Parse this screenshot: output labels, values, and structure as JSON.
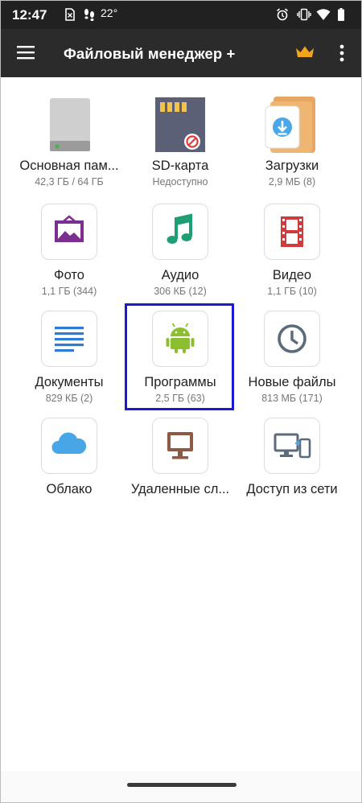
{
  "status_bar": {
    "time": "12:47",
    "temperature": "22°",
    "icons": [
      "sim-icon",
      "footsteps-icon",
      "alarm-icon",
      "vibrate-icon",
      "wifi-icon",
      "battery-icon"
    ]
  },
  "app_bar": {
    "title": "Файловый менеджер +",
    "icons": [
      "menu-icon",
      "crown-icon",
      "more-vert-icon"
    ],
    "accent_color": "#f2a51a"
  },
  "tiles": [
    {
      "label": "Основная пам...",
      "sub": "42,3 ГБ / 64 ГБ",
      "icon": "storage-drive-icon"
    },
    {
      "label": "SD-карта",
      "sub": "Недоступно",
      "icon": "sd-card-icon"
    },
    {
      "label": "Загрузки",
      "sub": "2,9 МБ (8)",
      "icon": "downloads-folder-icon"
    },
    {
      "label": "Фото",
      "sub": "1,1 ГБ (344)",
      "icon": "photo-icon"
    },
    {
      "label": "Аудио",
      "sub": "306 КБ (12)",
      "icon": "music-note-icon"
    },
    {
      "label": "Видео",
      "sub": "1,1 ГБ (10)",
      "icon": "film-icon"
    },
    {
      "label": "Документы",
      "sub": "829 КБ (2)",
      "icon": "document-lines-icon"
    },
    {
      "label": "Программы",
      "sub": "2,5 ГБ (63)",
      "icon": "android-icon"
    },
    {
      "label": "Новые файлы",
      "sub": "813 МБ (171)",
      "icon": "clock-icon"
    },
    {
      "label": "Облако",
      "sub": "",
      "icon": "cloud-icon"
    },
    {
      "label": "Удаленные сл...",
      "sub": "",
      "icon": "monitor-icon"
    },
    {
      "label": "Доступ из сети",
      "sub": "",
      "icon": "devices-icon"
    }
  ],
  "highlighted_tile": "Программы"
}
